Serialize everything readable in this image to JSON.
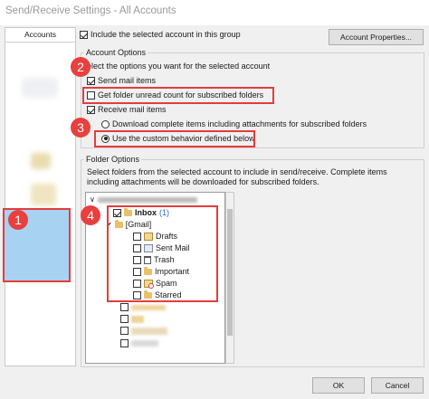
{
  "window": {
    "title": "Send/Receive Settings - All Accounts"
  },
  "accounts_panel": {
    "header": "Accounts"
  },
  "include_account": {
    "label": "Include the selected account in this group",
    "checked": true
  },
  "account_properties_button": "Account Properties...",
  "account_options": {
    "legend": "Account Options",
    "instruction": "elect the options you want for the selected account",
    "send_mail": {
      "label": "Send mail items",
      "checked": true
    },
    "unread_count": {
      "label": "Get folder unread count for subscribed folders",
      "checked": false
    },
    "receive_mail": {
      "label": "Receive mail items",
      "checked": true
    },
    "download_complete": {
      "label": "Download complete items including attachments for subscribed folders",
      "selected": false
    },
    "custom_behavior": {
      "label": "Use the custom behavior defined below",
      "selected": true
    }
  },
  "folder_options": {
    "legend": "Folder Options",
    "description": "Select folders from the selected account to include in send/receive. Complete items including attachments will be downloaded for subscribed folders."
  },
  "folder_tree": {
    "inbox": {
      "label": "Inbox",
      "count": "(1)",
      "checked": true
    },
    "gmail": {
      "label": "[Gmail]"
    },
    "subfolders": [
      {
        "label": "Drafts",
        "icon": "drafts-icon"
      },
      {
        "label": "Sent Mail",
        "icon": "sent-mail-icon"
      },
      {
        "label": "Trash",
        "icon": "trash-icon"
      },
      {
        "label": "Important",
        "icon": "folder-icon"
      },
      {
        "label": "Spam",
        "icon": "spam-icon"
      },
      {
        "label": "Starred",
        "icon": "folder-icon"
      }
    ]
  },
  "badges": [
    "1",
    "2",
    "3",
    "4"
  ],
  "buttons": {
    "ok": "OK",
    "cancel": "Cancel"
  },
  "colors": {
    "highlight_red": "#e33d3d",
    "selection_blue": "#a8d2f2"
  }
}
